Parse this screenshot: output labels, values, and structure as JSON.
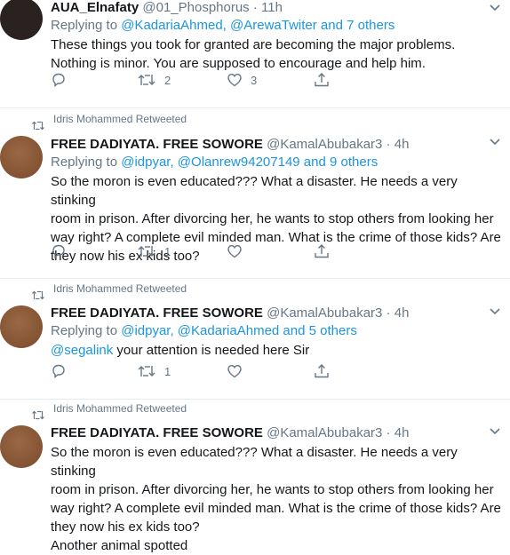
{
  "tweets": [
    {
      "retweeted_by": "",
      "name": "AUA_Elnafaty",
      "handle": "@01_Phosphorus",
      "time": "· 11h",
      "replying_prefix": "Replying to ",
      "replying_links": "@KadariaAhmed, @ArewaTwiter and 7 others",
      "body": [
        "These things you took for granted are becoming the major problems.",
        "Nothing is minor. You are supposed to encourage and help him."
      ],
      "replies": "",
      "retweets": "2",
      "likes": "3",
      "avatar_color": "#2a2220"
    },
    {
      "retweeted_by": "Idris Mohammed Retweeted",
      "name": "FREE DADIYATA. FREE SOWORE",
      "handle": "@KamalAbubakar3 · 4h",
      "replying_prefix": "Replying to ",
      "replying_links": "@idpyar, @Olanrew94207149 and 9 others",
      "body": [
        "So the moron is even educated??? What a disaster. He needs a very stinking",
        "room in prison. After divorcing her, he wants to stop others from looking her",
        "way right? A complete evil minded man. What is the crime of those kids? Are",
        "they now his ex kids too?"
      ],
      "replies": "",
      "retweets": "1",
      "likes": "",
      "avatar_color": "#8a5a38"
    },
    {
      "retweeted_by": "Idris Mohammed Retweeted",
      "name": "FREE DADIYATA. FREE SOWORE",
      "handle": "@KamalAbubakar3 · 4h",
      "replying_prefix": "Replying to ",
      "replying_links": "@idpyar, @KadariaAhmed and 5 others",
      "body_link": "@segalink",
      "body_rest": " your attention is needed here Sir",
      "replies": "",
      "retweets": "1",
      "likes": "",
      "avatar_color": "#8a5a38"
    },
    {
      "retweeted_by": "Idris Mohammed Retweeted",
      "name": "FREE DADIYATA. FREE SOWORE",
      "handle": "@KamalAbubakar3 · 4h",
      "body": [
        "So the moron is even educated??? What a disaster. He needs a very stinking",
        "room in prison. After divorcing her, he wants to stop others from looking her",
        "way right? A complete evil minded man. What is the crime of those kids? Are",
        "they now his ex kids too?",
        "Another animal spotted"
      ],
      "avatar_color": "#8a5a38"
    }
  ],
  "icons": {
    "reply": "reply-icon",
    "retweet": "retweet-icon",
    "like": "heart-icon",
    "share": "share-icon",
    "more": "chevron-down-icon"
  }
}
